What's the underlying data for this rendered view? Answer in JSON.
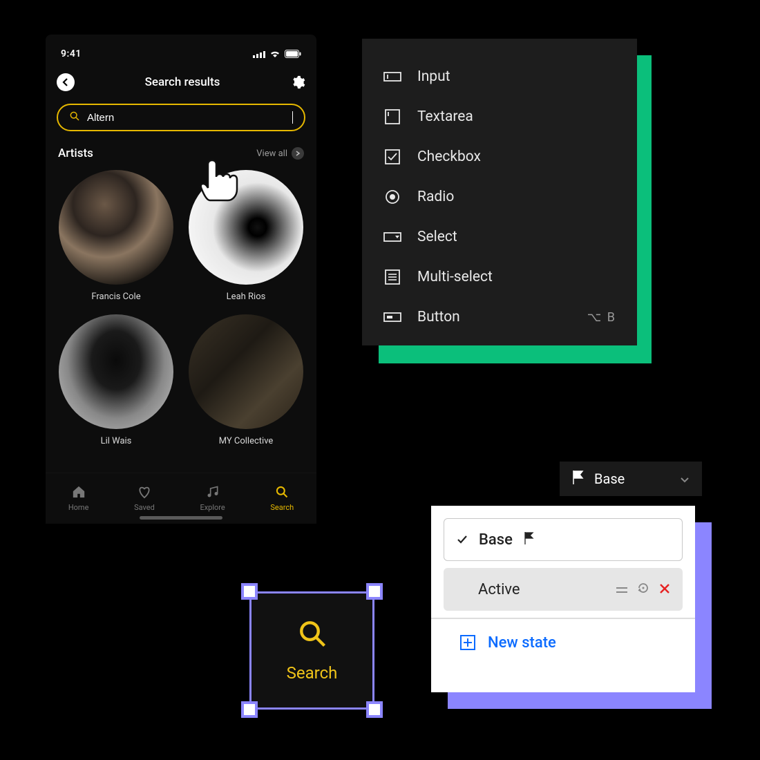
{
  "phone": {
    "time": "9:41",
    "title": "Search results",
    "search_value": "Altern",
    "section_title": "Artists",
    "view_all": "View all",
    "artists": [
      {
        "name": "Francis Cole"
      },
      {
        "name": "Leah Rios"
      },
      {
        "name": "Lil Wais"
      },
      {
        "name": "MY Collective"
      }
    ],
    "tabs": {
      "home": "Home",
      "saved": "Saved",
      "explore": "Explore",
      "search": "Search"
    }
  },
  "form_panel": {
    "items": [
      {
        "label": "Input",
        "icon": "input"
      },
      {
        "label": "Textarea",
        "icon": "textarea"
      },
      {
        "label": "Checkbox",
        "icon": "checkbox"
      },
      {
        "label": "Radio",
        "icon": "radio"
      },
      {
        "label": "Select",
        "icon": "select"
      },
      {
        "label": "Multi-select",
        "icon": "multiselect"
      },
      {
        "label": "Button",
        "icon": "button",
        "shortcut": "⌥ B"
      }
    ]
  },
  "selected_tile": {
    "label": "Search"
  },
  "base_dropdown": {
    "label": "Base"
  },
  "states_panel": {
    "base": "Base",
    "active": "Active",
    "new_state": "New state"
  }
}
